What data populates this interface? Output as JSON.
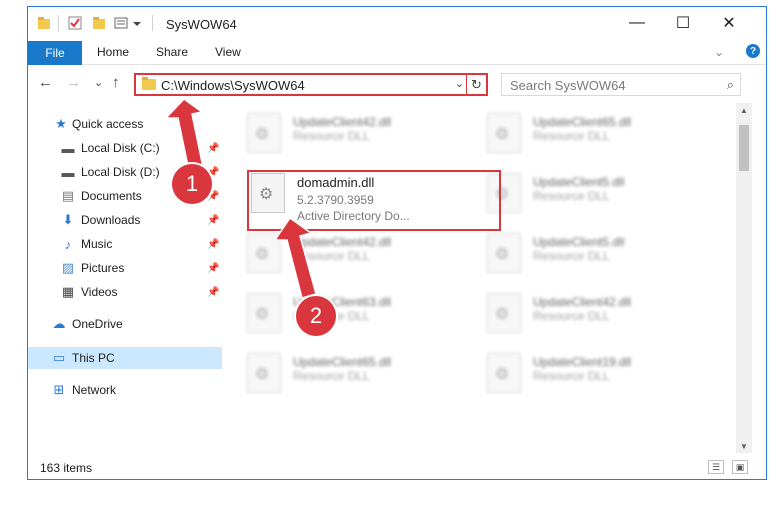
{
  "window": {
    "title": "SysWOW64",
    "controls": {
      "minimize": "—",
      "maximize": "☐",
      "close": "✕"
    }
  },
  "ribbon": {
    "tabs": [
      "File",
      "Home",
      "Share",
      "View"
    ],
    "expand": "⌄",
    "help": "?"
  },
  "nav": {
    "back": "←",
    "forward": "→",
    "recent": "⌄",
    "up": "↑",
    "address": "C:\\Windows\\SysWOW64",
    "address_drop": "⌄",
    "refresh": "↻",
    "search_placeholder": "Search SysWOW64",
    "search_icon": "⌕"
  },
  "sidebar": {
    "items": [
      {
        "label": "Quick access",
        "icon": "star-icon",
        "glyph": "★",
        "pinned": false
      },
      {
        "label": "Local Disk (C:)",
        "icon": "drive-icon",
        "glyph": "▬",
        "pinned": true
      },
      {
        "label": "Local Disk (D:)",
        "icon": "drive-icon",
        "glyph": "▬",
        "pinned": true
      },
      {
        "label": "Documents",
        "icon": "documents-icon",
        "glyph": "▤",
        "pinned": true
      },
      {
        "label": "Downloads",
        "icon": "download-icon",
        "glyph": "⬇",
        "pinned": true
      },
      {
        "label": "Music",
        "icon": "music-icon",
        "glyph": "♪",
        "pinned": true
      },
      {
        "label": "Pictures",
        "icon": "pictures-icon",
        "glyph": "▨",
        "pinned": true
      },
      {
        "label": "Videos",
        "icon": "videos-icon",
        "glyph": "▦",
        "pinned": true
      },
      {
        "label": "OneDrive",
        "icon": "cloud-icon",
        "glyph": "☁",
        "pinned": false
      },
      {
        "label": "This PC",
        "icon": "computer-icon",
        "glyph": "▭",
        "pinned": false
      },
      {
        "label": "Network",
        "icon": "network-icon",
        "glyph": "⊞",
        "pinned": false
      }
    ],
    "pin_glyph": "📌"
  },
  "files": {
    "highlighted": {
      "name": "domadmin.dll",
      "version": "5.2.3790.3959",
      "description": "Active Directory Do..."
    },
    "background": [
      {
        "name": "UpdateClient42.dll",
        "type": "Resource DLL"
      },
      {
        "name": "UpdateClient65.dll",
        "type": "Resource DLL"
      },
      {
        "name": "UpdateClient5.dll",
        "type": "Resource DLL"
      },
      {
        "name": "UpdateClient42.dll",
        "type": "Resource DLL"
      },
      {
        "name": "UpdateClient5.dll",
        "type": "Resource DLL"
      },
      {
        "name": "UpdateClient63.dll",
        "type": "Resource DLL"
      },
      {
        "name": "UpdateClient42.dll",
        "type": "Resource DLL"
      },
      {
        "name": "UpdateClient65.dll",
        "type": "Resource DLL"
      },
      {
        "name": "UpdateClient19.dll",
        "type": "Resource DLL"
      }
    ]
  },
  "status": {
    "item_count": "163 items",
    "view_details": "☰",
    "view_tiles": "▣"
  },
  "annotations": {
    "step1": "1",
    "step2": "2",
    "accent_color": "#d9363e"
  },
  "colors": {
    "file_tab": "#1979ca",
    "selection": "#cce8ff",
    "annotation": "#d9363e"
  }
}
